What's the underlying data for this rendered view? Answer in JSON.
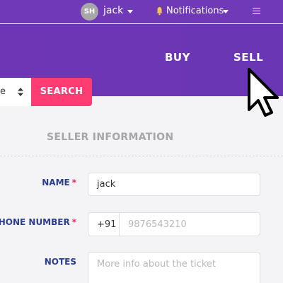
{
  "topbar": {
    "avatar_initials": "SH",
    "user_name": "jack",
    "notifications_label": "Notifications",
    "colors": {
      "background": "#6f39b8"
    }
  },
  "hero": {
    "nav": {
      "buy": "BUY",
      "sell": "SELL"
    },
    "search": {
      "select_value": "e",
      "button_label": "SEARCH"
    },
    "colors": {
      "gradient": "#6a36b4",
      "search_button": "#ff3d73"
    }
  },
  "form": {
    "section_title": "SELLER INFORMATION",
    "name": {
      "label": "NAME",
      "required_mark": "*",
      "value": "jack"
    },
    "phone": {
      "label": "HONE NUMBER",
      "required_mark": "*",
      "prefix": "+91",
      "placeholder": "9876543210"
    },
    "notes": {
      "label": "NOTES",
      "placeholder": "More info about the ticket"
    },
    "colors": {
      "label": "#2c3e8f",
      "required": "#e0245e"
    }
  }
}
